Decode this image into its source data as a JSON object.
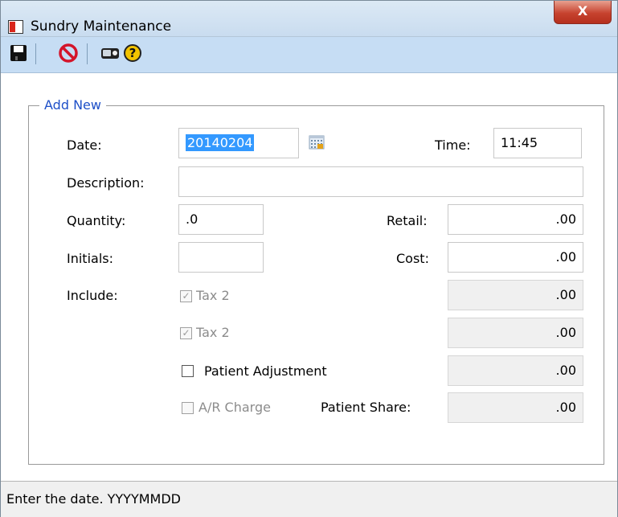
{
  "window": {
    "title": "Sundry Maintenance",
    "close_label": "X"
  },
  "toolbar": {
    "buttons": [
      "save-icon",
      "cancel-icon",
      "scan-icon",
      "help-icon"
    ]
  },
  "group": {
    "legend": "Add New"
  },
  "form": {
    "date_label": "Date:",
    "date_value": "20140204",
    "time_label": "Time:",
    "time_value": "11:45",
    "description_label": "Description:",
    "description_value": "",
    "quantity_label": "Quantity:",
    "quantity_value": ".0",
    "retail_label": "Retail:",
    "retail_value": ".00",
    "initials_label": "Initials:",
    "initials_value": "",
    "cost_label": "Cost:",
    "cost_value": ".00",
    "include_label": "Include:",
    "tax2a_label": "Tax 2",
    "tax2a_amount": ".00",
    "tax2b_label": "Tax 2",
    "tax2b_amount": ".00",
    "patient_adjustment_label": "Patient Adjustment",
    "patient_adjustment_amount": ".00",
    "ar_charge_label": "A/R Charge",
    "patient_share_label": "Patient Share:",
    "patient_share_amount": ".00"
  },
  "status": {
    "text": "Enter the date. YYYYMMDD"
  },
  "colors": {
    "legend": "#1e50c8",
    "toolbar": "#c6ddf4",
    "selection": "#3399ff"
  }
}
